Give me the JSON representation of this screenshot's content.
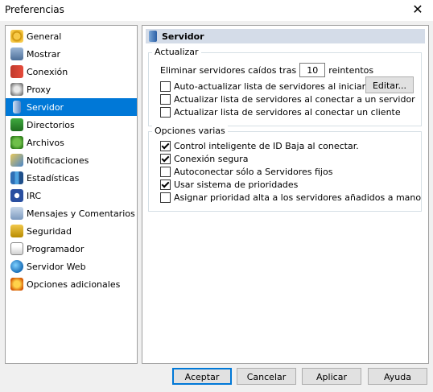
{
  "window": {
    "title": "Preferencias"
  },
  "sidebar": {
    "items": [
      {
        "label": "General",
        "icon": "gear-icon"
      },
      {
        "label": "Mostrar",
        "icon": "display-icon"
      },
      {
        "label": "Conexión",
        "icon": "connection-icon"
      },
      {
        "label": "Proxy",
        "icon": "proxy-icon"
      },
      {
        "label": "Servidor",
        "icon": "server-icon",
        "selected": true
      },
      {
        "label": "Directorios",
        "icon": "folder-icon"
      },
      {
        "label": "Archivos",
        "icon": "files-icon"
      },
      {
        "label": "Notificaciones",
        "icon": "notification-icon"
      },
      {
        "label": "Estadísticas",
        "icon": "stats-icon"
      },
      {
        "label": "IRC",
        "icon": "irc-icon"
      },
      {
        "label": "Mensajes y Comentarios",
        "icon": "messages-icon"
      },
      {
        "label": "Seguridad",
        "icon": "lock-icon"
      },
      {
        "label": "Programador",
        "icon": "scheduler-icon"
      },
      {
        "label": "Servidor Web",
        "icon": "globe-icon"
      },
      {
        "label": "Opciones adicionales",
        "icon": "extras-icon"
      }
    ]
  },
  "panel": {
    "title": "Servidor",
    "update_group": {
      "legend": "Actualizar",
      "remove_label_before": "Eliminar servidores caídos tras",
      "retries_value": "10",
      "remove_label_after": "reintentos",
      "edit_button": "Editar...",
      "checkboxes": [
        {
          "label": "Auto-actualizar lista de servidores al iniciar",
          "checked": false
        },
        {
          "label": "Actualizar lista de servidores al conectar a un servidor",
          "checked": false
        },
        {
          "label": "Actualizar lista de servidores al conectar un cliente",
          "checked": false
        }
      ]
    },
    "misc_group": {
      "legend": "Opciones varias",
      "checkboxes": [
        {
          "label": "Control inteligente de ID Baja al conectar.",
          "checked": true
        },
        {
          "label": "Conexión segura",
          "checked": true
        },
        {
          "label": "Autoconectar sólo a Servidores fijos",
          "checked": false
        },
        {
          "label": "Usar sistema de prioridades",
          "checked": true
        },
        {
          "label": "Asignar prioridad alta a los servidores añadidos a mano",
          "checked": false
        }
      ]
    }
  },
  "footer": {
    "accept": "Aceptar",
    "cancel": "Cancelar",
    "apply": "Aplicar",
    "help": "Ayuda"
  },
  "colors": {
    "selection": "#0078d7",
    "header_bg": "#d4dce8",
    "window_bg": "#f0f0f0"
  }
}
